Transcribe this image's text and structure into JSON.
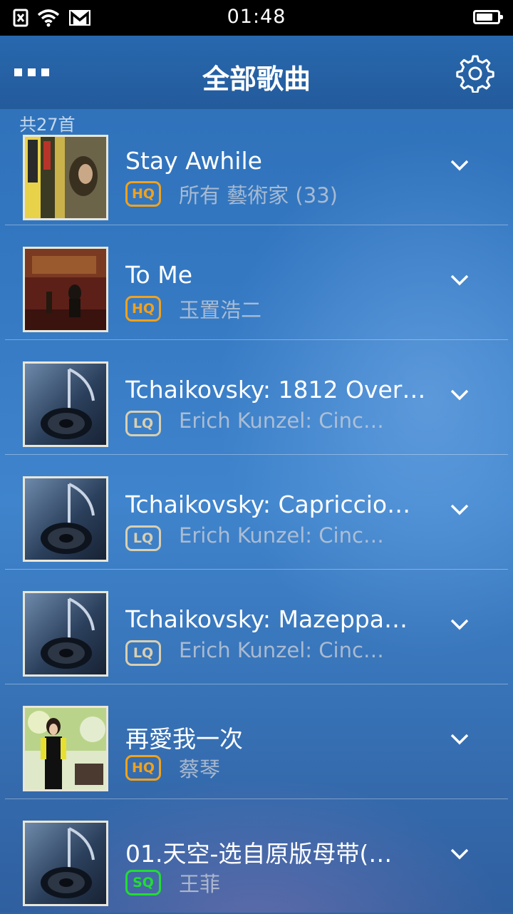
{
  "status_bar": {
    "time": "01:48",
    "battery_level": 0.8
  },
  "header": {
    "title": "全部歌曲",
    "menu_icon": "more-dots-icon",
    "settings_icon": "gear-icon"
  },
  "song_count": "共27首",
  "songs": [
    {
      "title": "Stay Awhile",
      "quality": "HQ",
      "artist": "所有 藝術家 (33)",
      "cover": "album-art"
    },
    {
      "title": "To Me",
      "quality": "HQ",
      "artist": "玉置浩二",
      "cover": "album-art"
    },
    {
      "title": "Tchaikovsky: 1812 Over…",
      "quality": "LQ",
      "artist": "Erich Kunzel: Cinc…",
      "cover": "music-note-speaker-icon"
    },
    {
      "title": "Tchaikovsky: Capriccio…",
      "quality": "LQ",
      "artist": "Erich Kunzel: Cinc…",
      "cover": "music-note-speaker-icon"
    },
    {
      "title": "Tchaikovsky: Mazeppa…",
      "quality": "LQ",
      "artist": "Erich Kunzel: Cinc…",
      "cover": "music-note-speaker-icon"
    },
    {
      "title": "再愛我一次",
      "quality": "HQ",
      "artist": "蔡琴",
      "cover": "album-art"
    },
    {
      "title": "01.天空-选自原版母带(…",
      "quality": "SQ",
      "artist": "王菲",
      "cover": "music-note-speaker-icon"
    }
  ],
  "colors": {
    "hq": "#f0a21e",
    "lq": "#d8cfb2",
    "sq": "#22dd33",
    "header": "#2868ae"
  }
}
